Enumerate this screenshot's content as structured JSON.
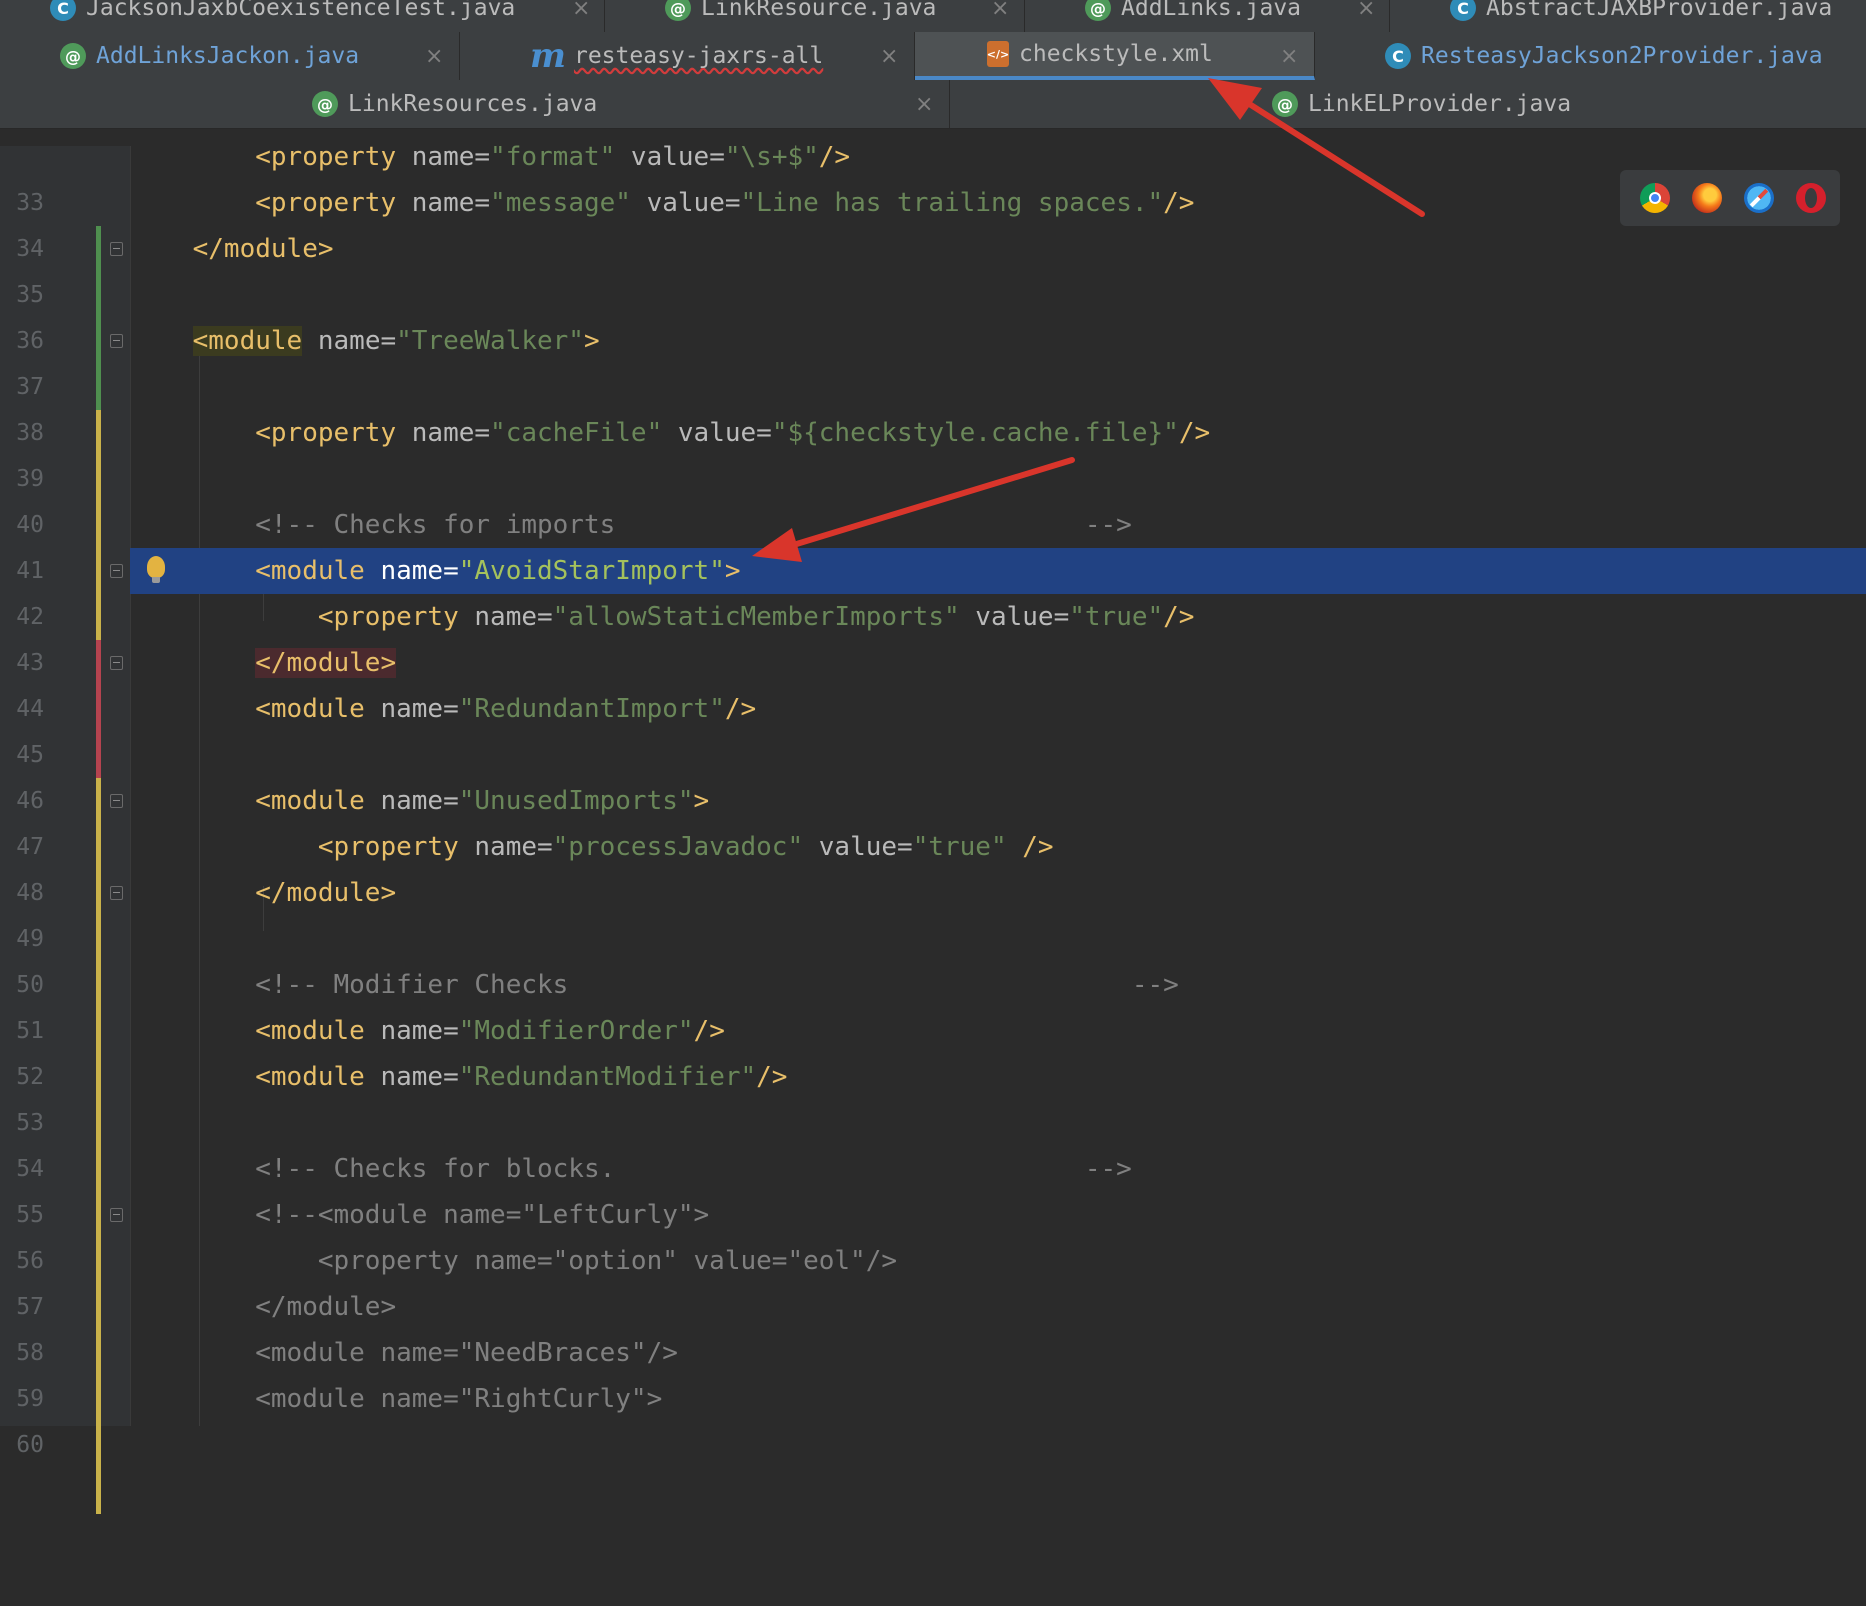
{
  "tab_rows": [
    [
      {
        "label": "JacksonJaxbCoexistenceTest.java",
        "icon": "class-icon"
      },
      {
        "label": "LinkResource.java",
        "icon": "annotation-icon"
      },
      {
        "label": "AddLinks.java",
        "icon": "annotation-icon"
      },
      {
        "label": "AbstractJAXBProvider.java",
        "icon": "class-icon"
      }
    ],
    [
      {
        "label": "AddLinksJackon.java",
        "icon": "annotation-icon"
      },
      {
        "label": "resteasy-jaxrs-all",
        "icon": "maven-icon"
      },
      {
        "label": "checkstyle.xml",
        "icon": "xml-icon",
        "active": true
      },
      {
        "label": "ResteasyJackson2Provider.java",
        "icon": "class-icon"
      }
    ],
    [
      {
        "label": "LinkResources.java",
        "icon": "annotation-icon"
      },
      {
        "label": "LinkELProvider.java",
        "icon": "annotation-icon"
      }
    ]
  ],
  "icon_glyphs": {
    "class": "C",
    "annotation": "@",
    "maven": "m",
    "xml": "</>",
    "close": "×"
  },
  "editor": {
    "line_numbers": [
      "33",
      "34",
      "35",
      "36",
      "37",
      "38",
      "39",
      "40",
      "41",
      "42",
      "43",
      "44",
      "45",
      "46",
      "47",
      "48",
      "49",
      "50",
      "51",
      "52",
      "53",
      "54",
      "55",
      "56",
      "57",
      "58",
      "59",
      "60"
    ],
    "highlighted_line": "42",
    "code": {
      "l33": {
        "indent": "        ",
        "tag_open": "<property",
        "attr1": " name=",
        "val1": "\"format\"",
        "attr2": " value=",
        "val2": "\"\\s+$\"",
        "close": "/>"
      },
      "l34": {
        "indent": "        ",
        "tag_open": "<property",
        "attr1": " name=",
        "val1": "\"message\"",
        "attr2": " value=",
        "val2": "\"Line has trailing spaces.\"",
        "close": "/>"
      },
      "l35": {
        "indent": "    ",
        "tag": "</module>"
      },
      "l37": {
        "indent": "    ",
        "tag_open": "<module",
        "attr1": " name=",
        "val1": "\"TreeWalker\"",
        "close": ">"
      },
      "l39": {
        "indent": "        ",
        "tag_open": "<property",
        "attr1": " name=",
        "val1": "\"cacheFile\"",
        "attr2": " value=",
        "val2": "\"${checkstyle.cache.file}\"",
        "close": "/>"
      },
      "l41": {
        "indent": "        ",
        "comment": "<!-- Checks for imports                              -->"
      },
      "l42": {
        "indent": "        ",
        "tag_open": "<module",
        "attr1": " name=",
        "val1": "\"AvoidStarImport\"",
        "close": ">"
      },
      "l43": {
        "indent": "            ",
        "tag_open": "<property",
        "attr1": " name=",
        "val1": "\"allowStaticMemberImports\"",
        "attr2": " value=",
        "val2": "\"true\"",
        "close": "/>"
      },
      "l44": {
        "indent": "        ",
        "tag": "</module>"
      },
      "l45": {
        "indent": "        ",
        "tag_open": "<module",
        "attr1": " name=",
        "val1": "\"RedundantImport\"",
        "close": "/>"
      },
      "l47": {
        "indent": "        ",
        "tag_open": "<module",
        "attr1": " name=",
        "val1": "\"UnusedImports\"",
        "close": ">"
      },
      "l48": {
        "indent": "            ",
        "tag_open": "<property",
        "attr1": " name=",
        "val1": "\"processJavadoc\"",
        "attr2": " value=",
        "val2": "\"true\"",
        "close": " />"
      },
      "l49": {
        "indent": "        ",
        "tag": "</module>"
      },
      "l51": {
        "indent": "        ",
        "comment": "<!-- Modifier Checks                                    -->"
      },
      "l52": {
        "indent": "        ",
        "tag_open": "<module",
        "attr1": " name=",
        "val1": "\"ModifierOrder\"",
        "close": "/>"
      },
      "l53": {
        "indent": "        ",
        "tag_open": "<module",
        "attr1": " name=",
        "val1": "\"RedundantModifier\"",
        "close": "/>"
      },
      "l55": {
        "indent": "        ",
        "comment": "<!-- Checks for blocks.                              -->"
      },
      "l56": {
        "indent": "        ",
        "comment": "<!--<module name=\"LeftCurly\">"
      },
      "l57": {
        "indent": "            ",
        "comment": "<property name=\"option\" value=\"eol\"/>"
      },
      "l58": {
        "indent": "        ",
        "comment": "</module>"
      },
      "l59": {
        "indent": "        ",
        "comment": "<module name=\"NeedBraces\"/>"
      },
      "l60": {
        "indent": "        ",
        "comment": "<module name=\"RightCurly\">"
      }
    }
  },
  "browser_icons": [
    "chrome-icon",
    "firefox-icon",
    "safari-icon",
    "opera-icon"
  ],
  "annotation_color": "#d9352b",
  "colors": {
    "tag": "#e8bf6a",
    "attr_value": "#6a8759",
    "comment": "#808080",
    "selection": "#214283",
    "active_tab_underline": "#4a88c7"
  }
}
